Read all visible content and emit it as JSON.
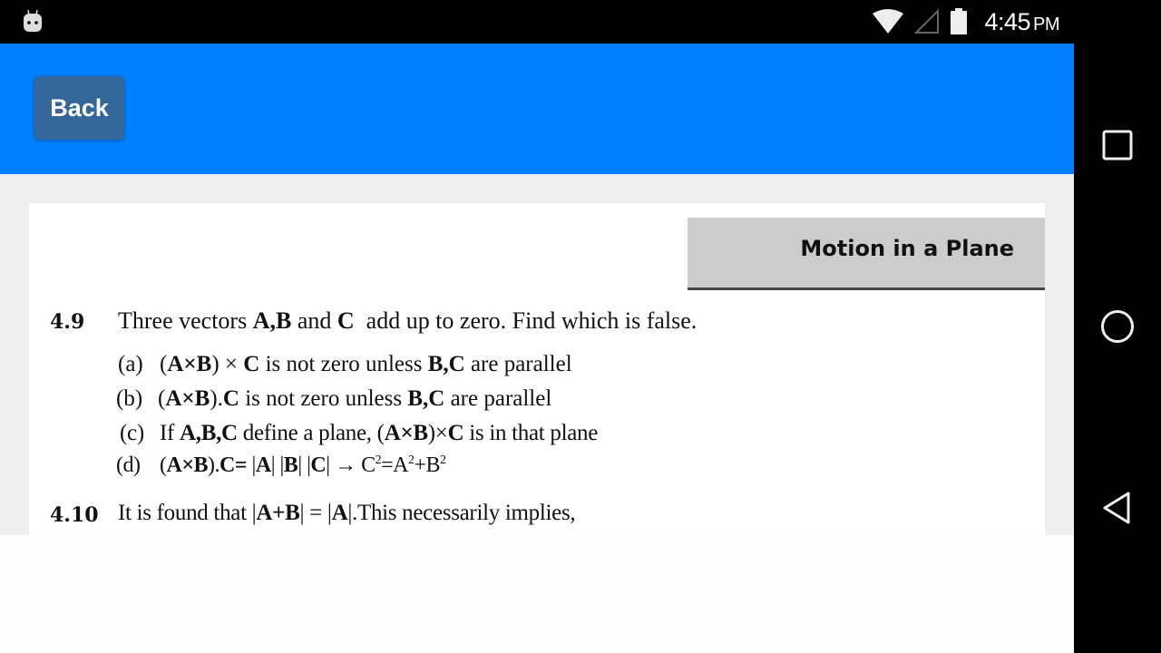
{
  "status_bar": {
    "time": "4:45",
    "ampm": "PM",
    "icons": [
      "android-debug-icon",
      "wifi-icon",
      "cell-signal-icon",
      "battery-icon"
    ]
  },
  "nav_bar": {
    "buttons": [
      "recents-square-icon",
      "home-circle-icon",
      "back-triangle-icon"
    ]
  },
  "app_bar": {
    "back_label": "Back",
    "color": "#0080ff",
    "back_color": "#36679a"
  },
  "document": {
    "chapter_title": "Motion in a Plane",
    "questions": [
      {
        "number": "4.9",
        "text_parts": [
          "Three vectors ",
          "A,B",
          " and ",
          "C",
          "  add up to zero. Find which is false."
        ],
        "options": [
          {
            "label": "(a)",
            "parts": [
              "(",
              "A×B",
              ") × ",
              "C",
              " is not zero unless ",
              "B,C",
              " are parallel"
            ]
          },
          {
            "label": "(b)",
            "parts": [
              "(",
              "A×B",
              ").",
              "C",
              " is not zero unless ",
              "B,C",
              " are parallel"
            ]
          },
          {
            "label": "(c)",
            "parts": [
              "If ",
              "A,B,C",
              " define a plane, (",
              "A×B",
              ")×",
              "C",
              " is in that plane"
            ]
          },
          {
            "label": "(d)",
            "parts": [
              "(",
              "A×B",
              ").",
              "C=",
              " |",
              "A",
              "| |",
              "B",
              "| |",
              "C",
              "| → C",
              "2",
              "=A",
              "2",
              "+B",
              "2"
            ]
          }
        ]
      },
      {
        "number": "4.10",
        "text_parts": [
          "It is found that |",
          "A+B",
          "| = |",
          "A",
          "|.This necessarily implies,"
        ]
      }
    ]
  }
}
